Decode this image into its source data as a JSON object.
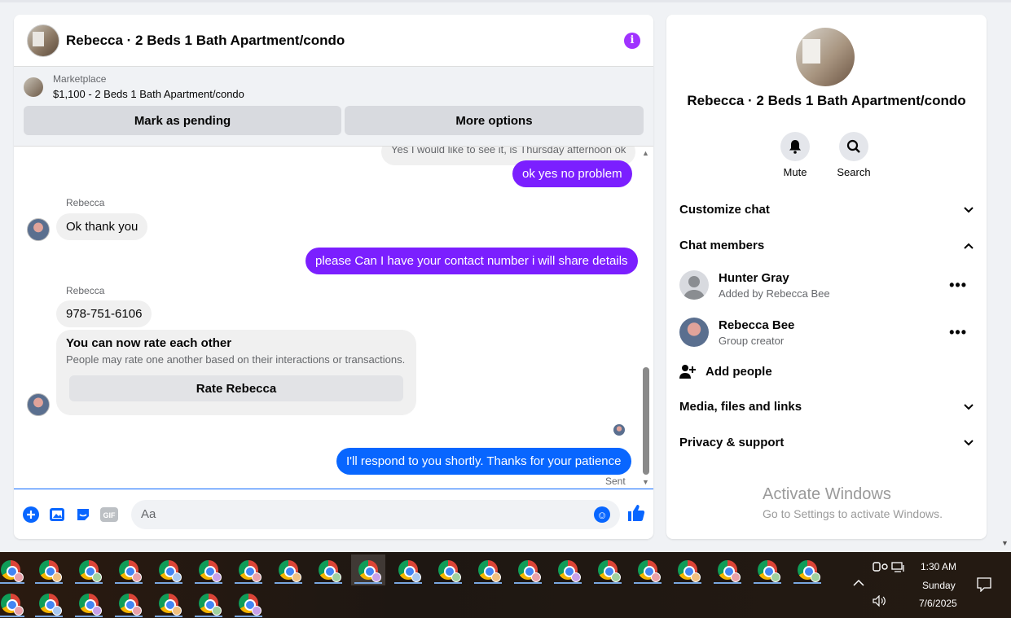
{
  "chat": {
    "title": "Rebecca · 2 Beds 1 Bath Apartment/condo",
    "marketplace_label": "Marketplace",
    "listing": "$1,100 - 2 Beds 1 Bath Apartment/condo",
    "mark_pending": "Mark as pending",
    "more_options": "More options"
  },
  "messages": {
    "quoted": "Yes I would like to see it, is Thursday afternoon ok",
    "m1": "ok yes no problem",
    "sender1": "Rebecca",
    "m2": "Ok thank you",
    "m3": "please Can I have your contact number i will share details",
    "sender2": "Rebecca",
    "m4": "978-751-6106",
    "rate_title": "You can now rate each other",
    "rate_sub": "People may rate one another based on their interactions or transactions.",
    "rate_button": "Rate Rebecca",
    "m5": "I'll respond to you shortly. Thanks for your patience",
    "status": "Sent"
  },
  "composer": {
    "placeholder": "Aa"
  },
  "info": {
    "title": "Rebecca · 2 Beds 1 Bath Apartment/condo",
    "mute": "Mute",
    "search": "Search",
    "customize": "Customize chat",
    "members": "Chat members",
    "member1_name": "Hunter Gray",
    "member1_sub": "Added by Rebecca Bee",
    "member2_name": "Rebecca Bee",
    "member2_sub": "Group creator",
    "add_people": "Add people",
    "media": "Media, files and links",
    "privacy": "Privacy & support",
    "activate1": "Activate Windows",
    "activate2": "Go to Settings to activate Windows."
  },
  "tray": {
    "time": "1:30 AM",
    "day": "Sunday",
    "date": "7/6/2025"
  },
  "colors": {
    "purple_bubble": "#7b1fff",
    "blue_bubble": "#0866ff",
    "accent": "#0866ff"
  }
}
